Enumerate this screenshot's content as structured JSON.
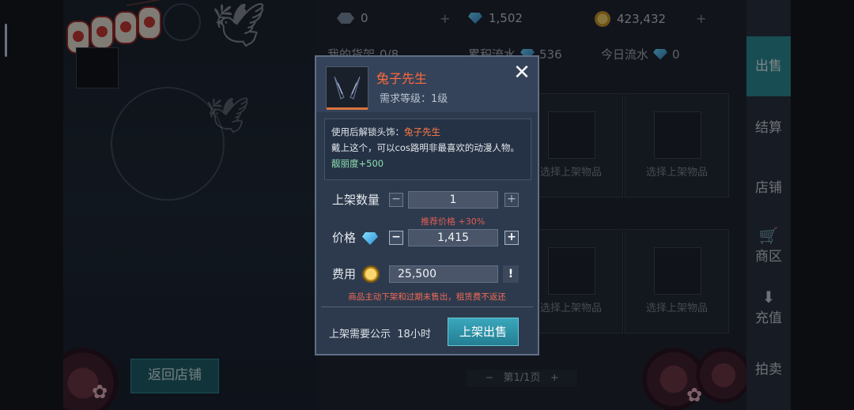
{
  "topbar": {
    "crystal_value": "0",
    "gem_value": "1,502",
    "coin_value": "423,432",
    "plus": "+",
    "close": "✕"
  },
  "stats": {
    "shelf_label": "我的货架",
    "shelf_value": "0/8",
    "total_flow_label": "累积流水",
    "total_flow_value": "536",
    "today_flow_label": "今日流水",
    "today_flow_value": "0"
  },
  "slots": {
    "caption": "选择上架物品"
  },
  "pager": {
    "label": "第1/1页",
    "prev": "−",
    "next": "+"
  },
  "left": {
    "return_label": "返回店铺"
  },
  "nav": {
    "items": [
      {
        "label": "出售"
      },
      {
        "label": "结算"
      },
      {
        "label": "店铺"
      },
      {
        "label": "商区"
      },
      {
        "label": "充值"
      },
      {
        "label": "拍卖"
      }
    ]
  },
  "dialog": {
    "title": "兔子先生",
    "required_level": "需求等级：1级",
    "close": "✕",
    "desc_line1_prefix": "使用后解锁头饰：",
    "desc_line1_highlight": "兔子先生",
    "desc_line2": "戴上这个，可以cos路明非最喜欢的动漫人物。",
    "desc_line3": "靓丽度+500",
    "qty_label": "上架数量",
    "qty_value": "1",
    "minus": "−",
    "plus": "+",
    "recommend_hint": "推荐价格 +30%",
    "price_label": "价格",
    "price_value": "1,415",
    "fee_label": "费用",
    "fee_value": "25,500",
    "fee_info": "!",
    "warning": "商品主动下架和过期未售出，租赁费不返还",
    "notice_label": "上架需要公示",
    "notice_value": "18小时",
    "sell_button": "上架出售"
  },
  "colors": {
    "accent": "#2c8d9a",
    "title_orange": "#ff6a3d",
    "warning_red": "#f06a58"
  }
}
